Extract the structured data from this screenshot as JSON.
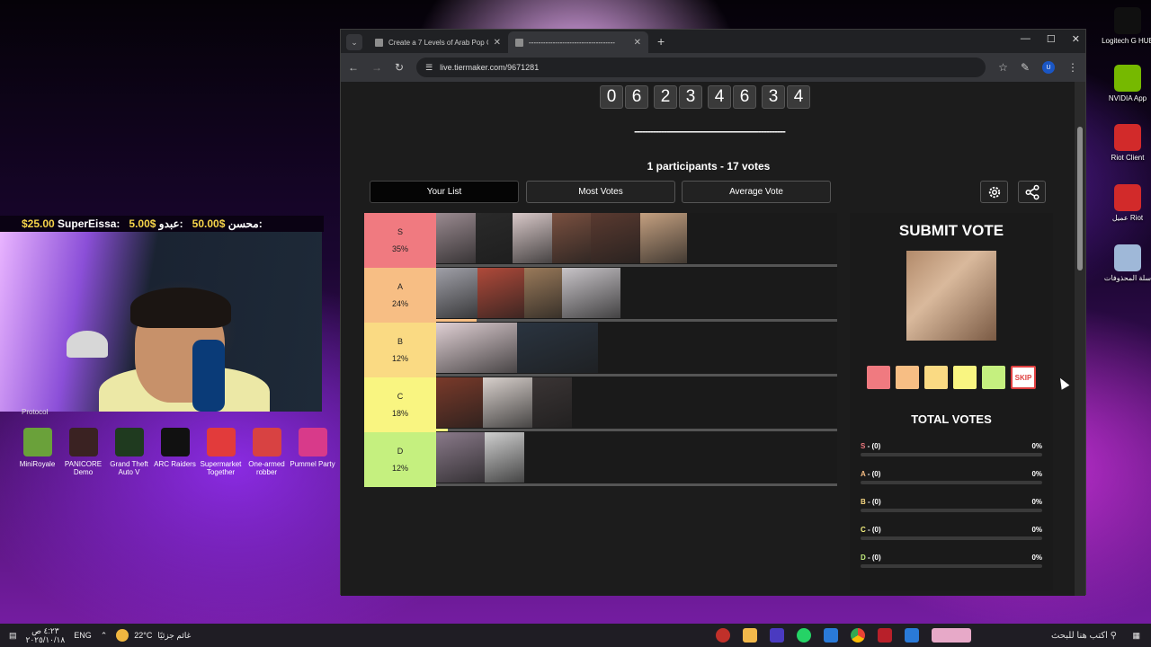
{
  "desktop_right": [
    {
      "label": "Logitech G HUB",
      "color": "#101010"
    },
    {
      "label": "NVIDIA App",
      "color": "#76b900"
    },
    {
      "label": "Riot Client",
      "color": "#d22a2a"
    },
    {
      "label": "عميل Riot",
      "color": "#d22a2a"
    },
    {
      "label": "سلة المحذوفات",
      "color": "#9fb8d8"
    }
  ],
  "donations": [
    {
      "name": "محسن:",
      "amount": "50.00$"
    },
    {
      "name": "عبدو:",
      "amount": "5.00$"
    },
    {
      "name": "SuperEissa:",
      "amount": "$25.00"
    }
  ],
  "protocol_text": "Protocol",
  "desktop_left": [
    {
      "label": "MiniRoyale",
      "color": "#6aa13a"
    },
    {
      "label": "PANICORE Demo",
      "color": "#3a2222"
    },
    {
      "label": "Grand Theft Auto V",
      "color": "#1f3a1f"
    },
    {
      "label": "ARC Raiders",
      "color": "#111111"
    },
    {
      "label": "Supermarket Together",
      "color": "#e23b3b"
    },
    {
      "label": "One-armed robber",
      "color": "#d84242"
    },
    {
      "label": "Pummel Party",
      "color": "#d83a8a"
    }
  ],
  "browser": {
    "tabs": [
      {
        "title": "Create a 7 Levels of Arab Pop G",
        "active": false
      },
      {
        "title": "------------------------------------",
        "active": true
      }
    ],
    "url": "live.tiermaker.com/9671281",
    "profile_initial": "U"
  },
  "counter": [
    [
      "0",
      "6"
    ],
    [
      "2",
      "3"
    ],
    [
      "4",
      "6"
    ],
    [
      "3",
      "4"
    ]
  ],
  "dashes": "--------------------------------------------------------",
  "participants": "1 participants - 17 votes",
  "view_buttons": [
    "Your List",
    "Most Votes",
    "Average Vote"
  ],
  "tiers": [
    {
      "name": "S",
      "pct": "35%",
      "color": "#f07a80",
      "fill": 0.0,
      "images": [
        "#9a8a90",
        "#2a2a2a",
        "#d8c8c8",
        "#7a5040",
        "#5a3a30",
        "#c4a080"
      ]
    },
    {
      "name": "A",
      "pct": "24%",
      "color": "#f7be84",
      "fill": 0.1,
      "images": [
        "#a0a0a8",
        "#b04a3a",
        "#9a7a5a",
        "#c8c4c8"
      ]
    },
    {
      "name": "B",
      "pct": "12%",
      "color": "#fada83",
      "fill": 0.0,
      "images": [
        "#e0d0d4",
        "#2a3440"
      ]
    },
    {
      "name": "C",
      "pct": "18%",
      "color": "#f9f581",
      "fill": 0.03,
      "images": [
        "#7a3a2a",
        "#d8d0cc",
        "#3a3434"
      ]
    },
    {
      "name": "D",
      "pct": "12%",
      "color": "#c5f07f",
      "fill": 0.0,
      "images": [
        "#8a7a8a",
        "#cfcfcf"
      ]
    }
  ],
  "submit_vote": "SUBMIT VOTE",
  "skip_label": "SKIP",
  "total_votes": "TOTAL VOTES",
  "vote_rows": [
    {
      "tier": "S",
      "text": " - (0)",
      "pct": "0%",
      "color": "#f07a80"
    },
    {
      "tier": "A",
      "text": " - (0)",
      "pct": "0%",
      "color": "#f7be84"
    },
    {
      "tier": "B",
      "text": " - (0)",
      "pct": "0%",
      "color": "#fada83"
    },
    {
      "tier": "C",
      "text": " - (0)",
      "pct": "0%",
      "color": "#f9f581"
    },
    {
      "tier": "D",
      "text": " - (0)",
      "pct": "0%",
      "color": "#c5f07f"
    }
  ],
  "taskbar": {
    "time": "٤:٢٣ ص",
    "date": "٢٠٢٥/١٠/١٨",
    "lang": "ENG",
    "temp": "22°C",
    "weather": "غائم جزئيًا",
    "search": "اكتب هنا للبحث"
  }
}
